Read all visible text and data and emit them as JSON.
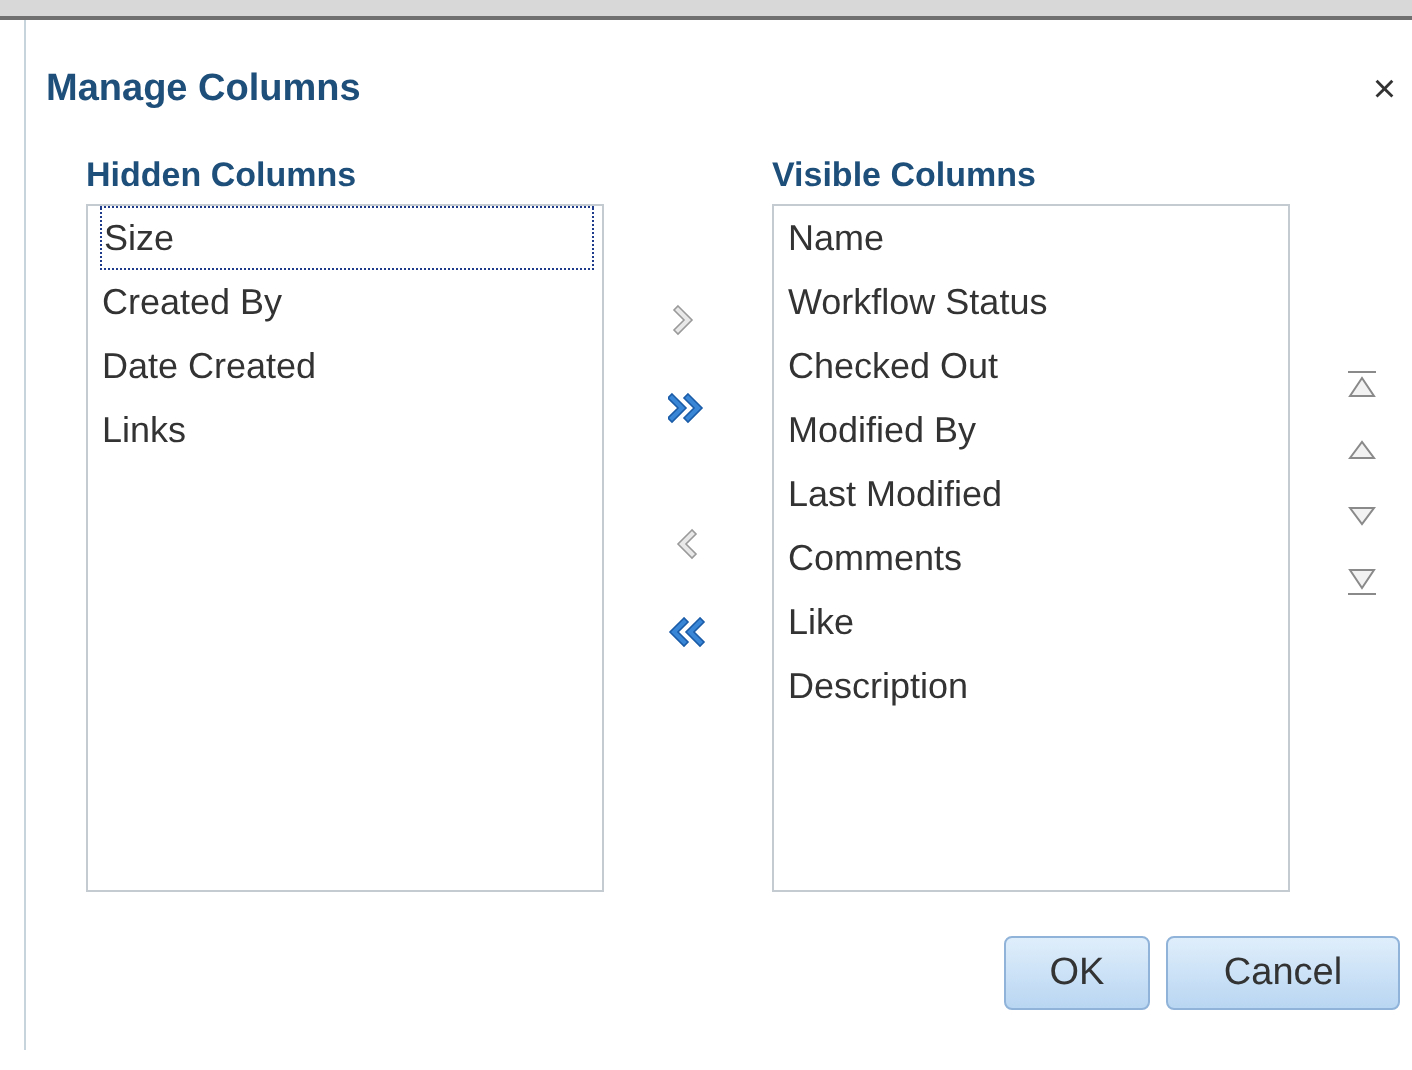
{
  "dialog": {
    "title": "Manage Columns",
    "close": "×"
  },
  "hidden": {
    "header": "Hidden Columns",
    "items": [
      {
        "label": "Size",
        "selected": true
      },
      {
        "label": "Created By",
        "selected": false
      },
      {
        "label": "Date Created",
        "selected": false
      },
      {
        "label": "Links",
        "selected": false
      }
    ]
  },
  "move_buttons": [
    {
      "kind": "move-one-right",
      "disabled": true
    },
    {
      "kind": "move-all-right",
      "disabled": false
    },
    {
      "kind": "move-one-left",
      "disabled": true
    },
    {
      "kind": "move-all-left",
      "disabled": false
    }
  ],
  "visible": {
    "header": "Visible Columns",
    "items": [
      {
        "label": "Name",
        "selected": false
      },
      {
        "label": "Workflow Status",
        "selected": false
      },
      {
        "label": "Checked Out",
        "selected": false
      },
      {
        "label": "Modified By",
        "selected": false
      },
      {
        "label": "Last Modified",
        "selected": false
      },
      {
        "label": "Comments",
        "selected": false
      },
      {
        "label": "Like",
        "selected": false
      },
      {
        "label": "Description",
        "selected": false
      }
    ]
  },
  "order_buttons": [
    {
      "kind": "top",
      "disabled": true
    },
    {
      "kind": "up",
      "disabled": true
    },
    {
      "kind": "down",
      "disabled": true
    },
    {
      "kind": "bottom",
      "disabled": true
    }
  ],
  "buttons": [
    "OK",
    "Cancel"
  ]
}
